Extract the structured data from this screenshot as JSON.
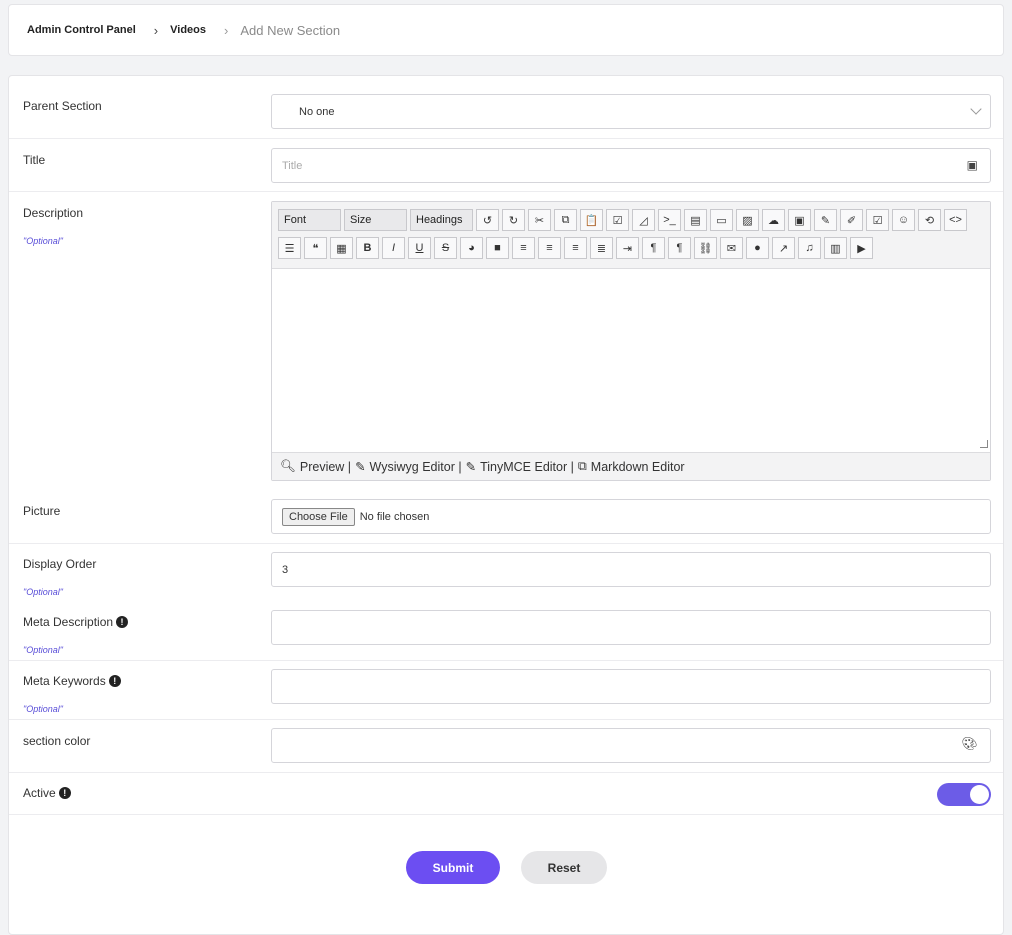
{
  "breadcrumb": {
    "items": [
      "Admin Control Panel",
      "Videos"
    ],
    "current": "Add New Section"
  },
  "form": {
    "parent_section": {
      "label": "Parent Section",
      "value": "No one"
    },
    "title": {
      "label": "Title",
      "placeholder": "Title"
    },
    "description": {
      "label": "Description",
      "optional": "\"Optional\"",
      "toolbar_selects": [
        "Font",
        "Size",
        "Headings"
      ],
      "toolbar_row1_icons": [
        "undo-icon",
        "redo-icon",
        "cut-icon",
        "copy-icon",
        "paste-icon",
        "select-all-icon",
        "eraser-icon",
        "terminal-icon",
        "file-icon",
        "rectangle-icon",
        "image-icon",
        "cloud-upload-icon",
        "archive-icon",
        "pencil-icon",
        "edit-icon",
        "check-edit-icon",
        "smiley-icon",
        "history-icon",
        "code-icon"
      ],
      "toolbar_row1_glyphs": [
        "↺",
        "↻",
        "✂",
        "⧉",
        "📋",
        "☑",
        "◿",
        ">_",
        "▤",
        "▭",
        "▨",
        "☁",
        "▣",
        "✎",
        "✐",
        "☑",
        "☺",
        "⟲",
        "<>"
      ],
      "toolbar_row2_icons": [
        "list-icon",
        "quote-icon",
        "qr-icon",
        "bold-icon",
        "italic-icon",
        "underline-icon",
        "strikethrough-icon",
        "palette-icon",
        "block-icon",
        "align-right-icon",
        "align-center-icon",
        "align-left-icon",
        "justify-icon",
        "indent-icon",
        "ltr-icon",
        "rtl-icon",
        "link-icon",
        "mail-icon",
        "comment-icon",
        "external-icon",
        "music-icon",
        "movie-icon",
        "youtube-icon"
      ],
      "toolbar_row2_glyphs": [
        "☰",
        "❝",
        "▦",
        "B",
        "I",
        "U",
        "S",
        "◕",
        "■",
        "≡",
        "≡",
        "≡",
        "≣",
        "⇥",
        "¶",
        "¶",
        "⛓",
        "✉",
        "●",
        "↗",
        "♫",
        "▥",
        "▶"
      ],
      "footer": {
        "preview": "Preview |",
        "wysiwyg": "Wysiwyg Editor |",
        "tinymce": "TinyMCE Editor |",
        "markdown": "Markdown Editor"
      }
    },
    "picture": {
      "label": "Picture",
      "button": "Choose File",
      "status": "No file chosen"
    },
    "display_order": {
      "label": "Display Order",
      "optional": "\"Optional\"",
      "value": "3"
    },
    "meta_description": {
      "label": "Meta Description",
      "optional": "\"Optional\"",
      "info": "!"
    },
    "meta_keywords": {
      "label": "Meta Keywords",
      "optional": "\"Optional\"",
      "info": "!"
    },
    "section_color": {
      "label": "section color"
    },
    "active": {
      "label": "Active",
      "info": "!",
      "enabled": true
    },
    "submit_label": "Submit",
    "reset_label": "Reset"
  },
  "colors": {
    "accent": "#6c4ef2",
    "toggle": "#6c5ce7",
    "optional_text": "#5a4fd8"
  }
}
